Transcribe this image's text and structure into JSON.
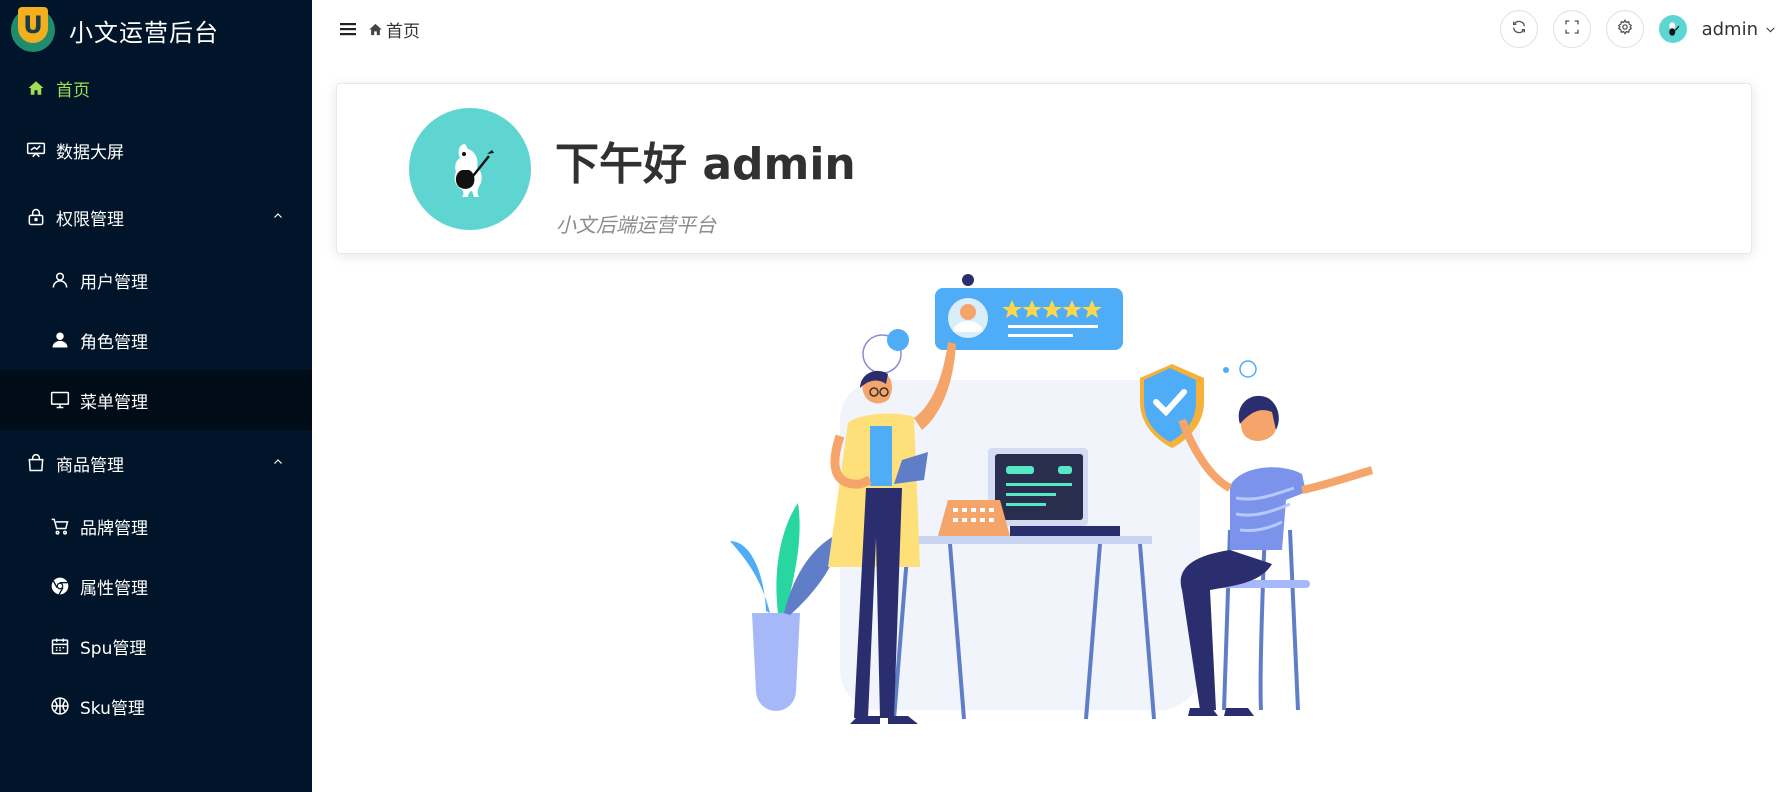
{
  "app": {
    "title": "小文运营后台",
    "logo_letter": "U"
  },
  "sidebar": {
    "items": [
      {
        "label": "首页",
        "icon": "home-icon",
        "active": true
      },
      {
        "label": "数据大屏",
        "icon": "screen-board-icon"
      },
      {
        "label": "权限管理",
        "icon": "lock-icon",
        "expanded": true,
        "children": [
          {
            "label": "用户管理",
            "icon": "user-outline-icon"
          },
          {
            "label": "角色管理",
            "icon": "user-filled-icon"
          },
          {
            "label": "菜单管理",
            "icon": "monitor-icon",
            "selected": true
          }
        ]
      },
      {
        "label": "商品管理",
        "icon": "shopping-bag-icon",
        "expanded": true,
        "children": [
          {
            "label": "品牌管理",
            "icon": "cart-icon"
          },
          {
            "label": "属性管理",
            "icon": "chrome-icon"
          },
          {
            "label": "Spu管理",
            "icon": "calendar-icon"
          },
          {
            "label": "Sku管理",
            "icon": "basketball-icon"
          }
        ]
      }
    ]
  },
  "header": {
    "breadcrumb": "首页",
    "username": "admin",
    "tools": [
      "refresh-icon",
      "fullscreen-icon",
      "settings-icon"
    ]
  },
  "welcome": {
    "greeting": "下午好 admin",
    "subtitle": "小文后端运营平台"
  },
  "colors": {
    "sidebar_bg": "#001529",
    "active_text": "#9ee04f",
    "avatar_bg": "#5fd5d1"
  }
}
